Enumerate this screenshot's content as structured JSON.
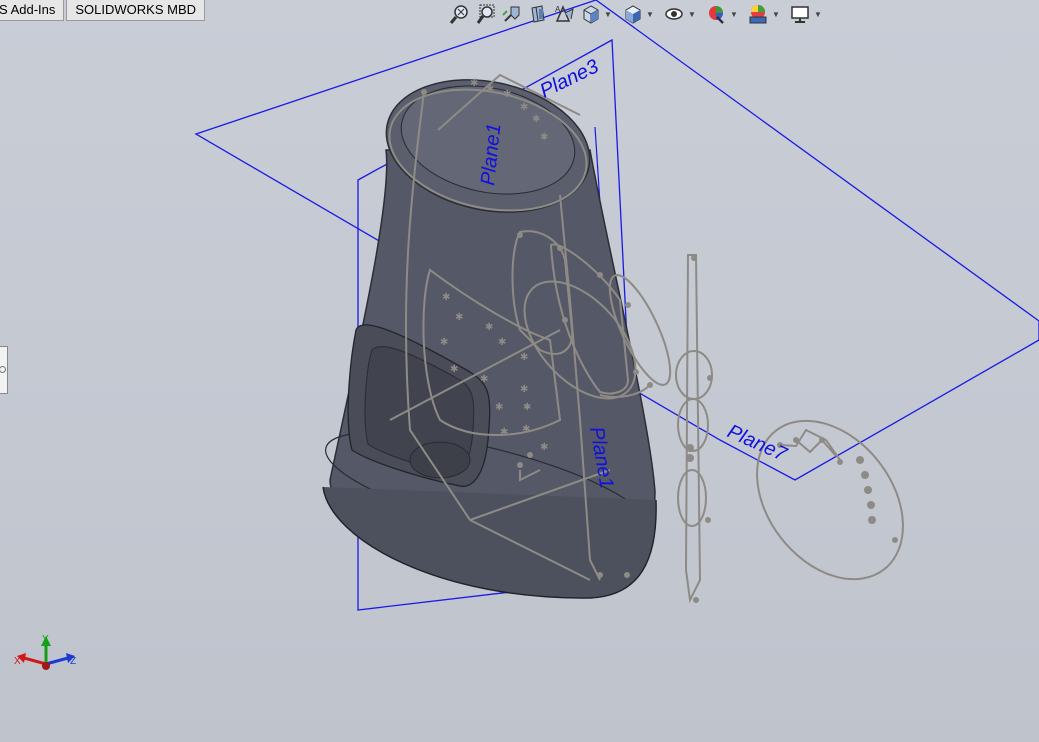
{
  "tabs": [
    {
      "label": "S Add-Ins"
    },
    {
      "label": "SOLIDWORKS MBD"
    }
  ],
  "heads_up_toolbar": {
    "buttons": [
      {
        "icon": "zoom-to-fit-icon"
      },
      {
        "icon": "zoom-to-area-icon"
      },
      {
        "icon": "previous-view-icon"
      },
      {
        "icon": "section-view-icon"
      },
      {
        "icon": "dynamic-annotation-views-icon"
      },
      {
        "icon": "view-orientation-icon",
        "dropdown": true
      },
      {
        "icon": "display-style-icon",
        "dropdown": true
      },
      {
        "icon": "hide-show-items-icon",
        "dropdown": true
      },
      {
        "icon": "edit-appearance-icon",
        "dropdown": true
      },
      {
        "icon": "apply-scene-icon",
        "dropdown": true
      },
      {
        "icon": "view-settings-icon",
        "dropdown": true
      }
    ]
  },
  "viewport": {
    "planes": [
      {
        "label": "Plane3"
      },
      {
        "label": "Plane1"
      },
      {
        "label": "Plane1"
      },
      {
        "label": "Plane7"
      }
    ],
    "triad": {
      "x": "X",
      "y": "Y",
      "z": "Z"
    },
    "colors": {
      "plane": "#1a1ae6",
      "body": "#565966",
      "sketch": "#8e8b86",
      "background": "#c6cad3"
    }
  }
}
